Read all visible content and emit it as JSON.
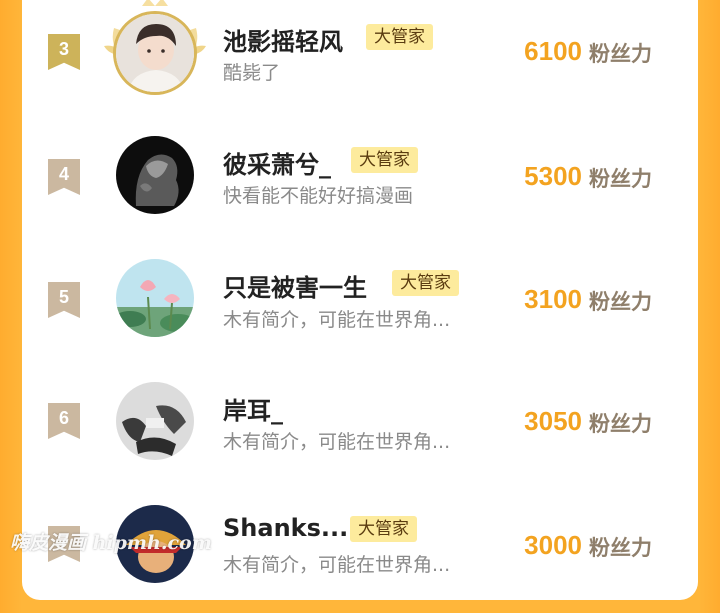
{
  "leaderboard": {
    "rows": [
      {
        "rank": "3",
        "name": "池影摇轻风",
        "badge": "大管家",
        "bio": "酷毙了",
        "score": "6100",
        "unit": "粉丝力"
      },
      {
        "rank": "4",
        "name": "彼采萧兮_",
        "badge": "大管家",
        "bio": "快看能不能好好搞漫画",
        "score": "5300",
        "unit": "粉丝力"
      },
      {
        "rank": "5",
        "name": "只是被害一生",
        "badge": "大管家",
        "bio": "木有简介，可能在世界角...",
        "score": "3100",
        "unit": "粉丝力"
      },
      {
        "rank": "6",
        "name": "岸耳_",
        "badge": "",
        "bio": "木有简介，可能在世界角...",
        "score": "3050",
        "unit": "粉丝力"
      },
      {
        "rank": "7",
        "name": "Shanks...",
        "badge": "大管家",
        "bio": "木有简介，可能在世界角...",
        "score": "3000",
        "unit": "粉丝力"
      }
    ]
  },
  "watermark": "嗨皮漫画 hipmh.com",
  "colors": {
    "accent": "#f3a320",
    "background": "#ffb63a",
    "badge": "#fdeb9d",
    "rank_gold": "#cdb35a",
    "rank_tan": "#cbb8a0"
  }
}
